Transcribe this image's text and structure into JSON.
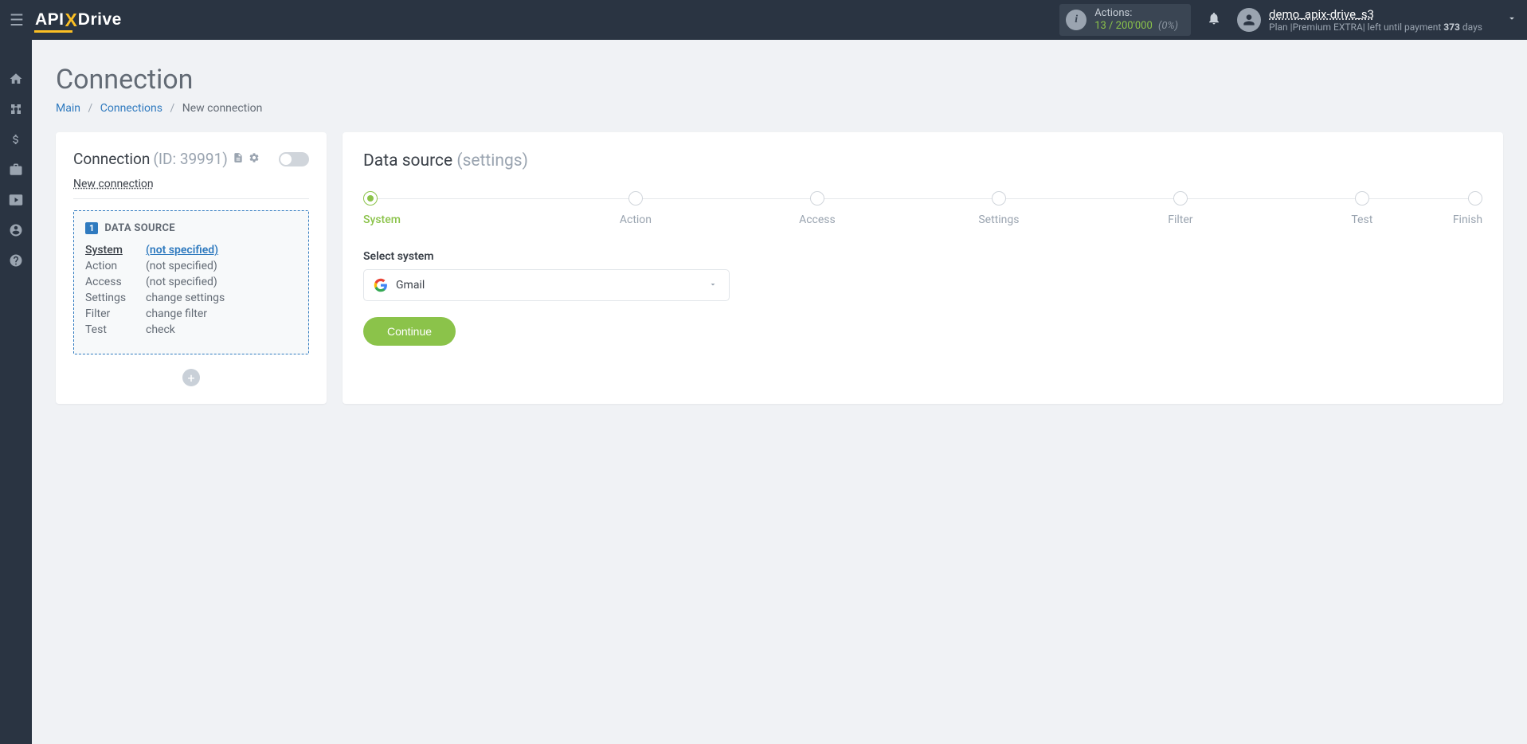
{
  "header": {
    "actions_label": "Actions:",
    "actions_used": "13",
    "actions_sep": " /",
    "actions_total": "200'000",
    "actions_pct": "(0%)",
    "user_name": "demo_apix-drive_s3",
    "plan_prefix": "Plan |",
    "plan_name": "Premium EXTRA",
    "plan_suffix_a": "| left until payment ",
    "plan_days": "373",
    "plan_suffix_b": " days"
  },
  "page": {
    "title": "Connection",
    "bc_main": "Main",
    "bc_connections": "Connections",
    "bc_current": "New connection"
  },
  "left": {
    "title": "Connection",
    "id": "(ID: 39991)",
    "name": "New connection",
    "badge": "1",
    "source_title": "DATA SOURCE",
    "rows": [
      {
        "k": "System",
        "v": "(not specified)",
        "active": true
      },
      {
        "k": "Action",
        "v": "(not specified)"
      },
      {
        "k": "Access",
        "v": "(not specified)"
      },
      {
        "k": "Settings",
        "v": "change settings"
      },
      {
        "k": "Filter",
        "v": "change filter"
      },
      {
        "k": "Test",
        "v": "check"
      }
    ]
  },
  "right": {
    "title": "Data source",
    "subtitle": "(settings)",
    "steps": [
      "System",
      "Action",
      "Access",
      "Settings",
      "Filter",
      "Test",
      "Finish"
    ],
    "active_step": 0,
    "select_label": "Select system",
    "selected": "Gmail",
    "continue": "Continue"
  }
}
